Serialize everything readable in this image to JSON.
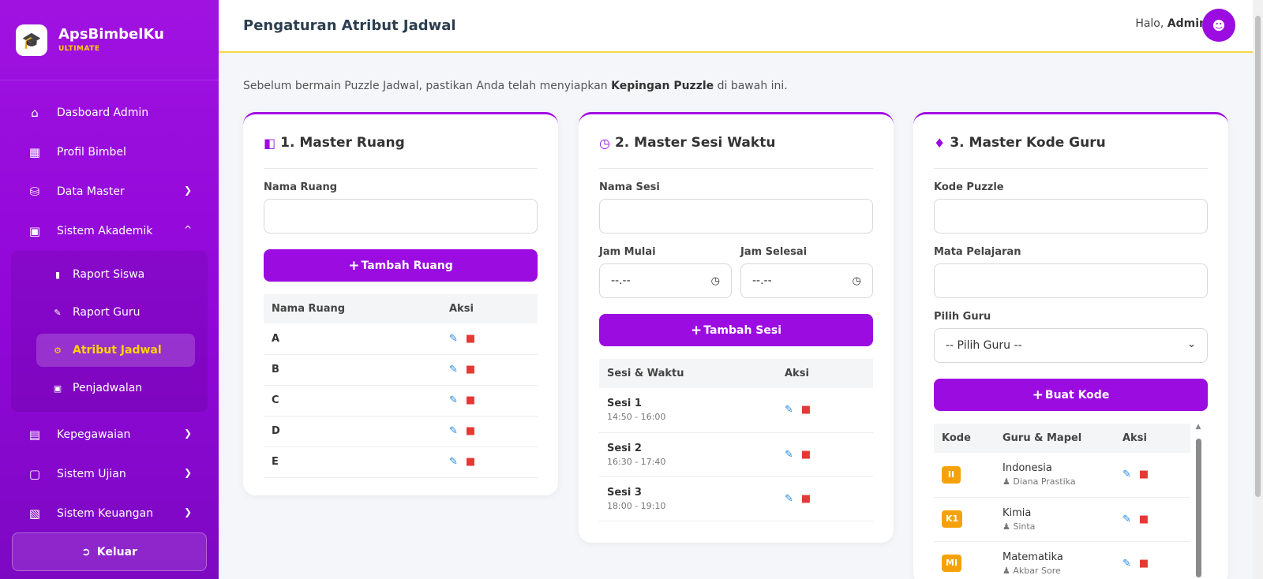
{
  "brand": {
    "name": "ApsBimbelKu",
    "sub": "ULTIMATE"
  },
  "nav": {
    "dashboard": "Dasboard Admin",
    "profil": "Profil Bimbel",
    "data_master": "Data Master",
    "akademik": "Sistem Akademik",
    "sub": {
      "raport_siswa": "Raport Siswa",
      "raport_guru": "Raport Guru",
      "atribut": "Atribut Jadwal",
      "penjadwalan": "Penjadwalan"
    },
    "kepegawaian": "Kepegawaian",
    "ujian": "Sistem Ujian",
    "keuangan": "Sistem Keuangan",
    "logout": "Keluar"
  },
  "header": {
    "title": "Pengaturan Atribut Jadwal",
    "greet": "Halo,",
    "user": "Admin"
  },
  "intro": {
    "pre": "Sebelum bermain Puzzle Jadwal, pastikan Anda telah menyiapkan",
    "bold": "Kepingan Puzzle",
    "post": "di bawah ini."
  },
  "ruang": {
    "title": "1. Master Ruang",
    "label": "Nama Ruang",
    "button": "Tambah Ruang",
    "col1": "Nama Ruang",
    "col2": "Aksi",
    "rows": [
      "A",
      "B",
      "C",
      "D",
      "E"
    ]
  },
  "sesi": {
    "title": "2. Master Sesi Waktu",
    "label": "Nama Sesi",
    "start_label": "Jam Mulai",
    "end_label": "Jam Selesai",
    "time_placeholder": "--.--",
    "button": "Tambah Sesi",
    "col1": "Sesi & Waktu",
    "col2": "Aksi",
    "rows": [
      {
        "name": "Sesi 1",
        "time": "14:50 - 16:00"
      },
      {
        "name": "Sesi 2",
        "time": "16:30 - 17:40"
      },
      {
        "name": "Sesi 3",
        "time": "18:00 - 19:10"
      }
    ]
  },
  "kode": {
    "title": "3. Master Kode Guru",
    "label_kode": "Kode Puzzle",
    "label_mapel": "Mata Pelajaran",
    "label_guru": "Pilih Guru",
    "select_value": "-- Pilih Guru --",
    "button": "Buat Kode",
    "col1": "Kode",
    "col2": "Guru & Mapel",
    "col3": "Aksi",
    "rows": [
      {
        "code": "II",
        "subject": "Indonesia",
        "teacher": "Diana Prastika"
      },
      {
        "code": "K1",
        "subject": "Kimia",
        "teacher": "Sinta"
      },
      {
        "code": "MI",
        "subject": "Matematika",
        "teacher": "Akbar Sore"
      }
    ]
  },
  "colors": {
    "primary": "#9b0ce0",
    "accent": "#ffd400",
    "badge": "#f5a20a",
    "edit": "#1e88e5",
    "delete": "#e53935"
  }
}
